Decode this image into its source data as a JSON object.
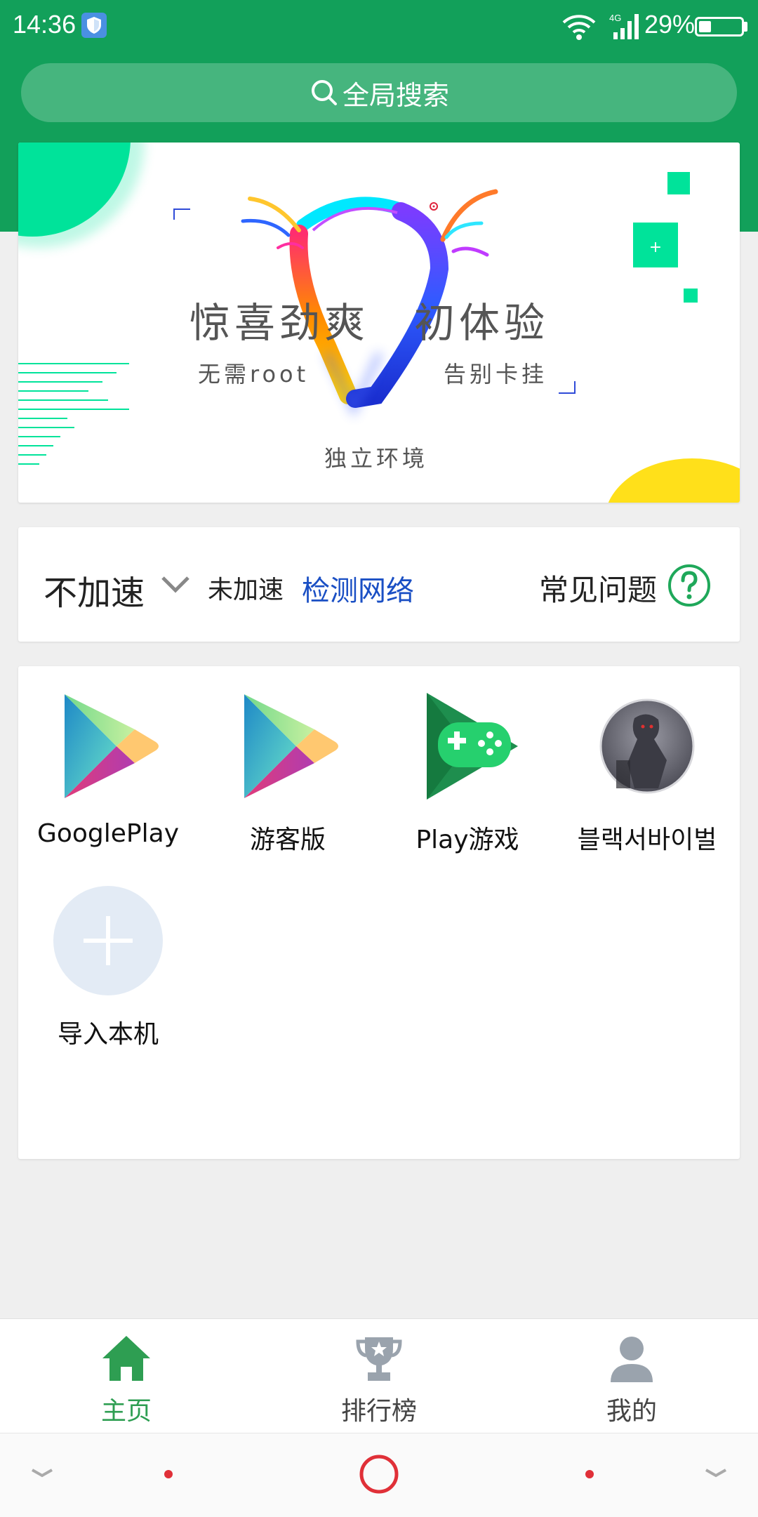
{
  "status_bar": {
    "time": "14:36",
    "network": "4G",
    "battery_percent": "29%",
    "battery_level": 0.29
  },
  "search": {
    "label": "全局搜索"
  },
  "banner": {
    "title": "惊喜劲爽　初体验",
    "sub_left": "无需root",
    "sub_right": "告别卡挂",
    "sub_bottom": "独立环境"
  },
  "speed": {
    "mode": "不加速",
    "status": "未加速",
    "check_network": "检测网络",
    "faq": "常见问题"
  },
  "apps": [
    {
      "label": "GooglePlay",
      "icon": "google-play-icon"
    },
    {
      "label": "游客版",
      "icon": "google-play-icon"
    },
    {
      "label": "Play游戏",
      "icon": "play-games-icon"
    },
    {
      "label": "블랙서바이벌",
      "icon": "game-avatar-icon"
    },
    {
      "label": "导入本机",
      "icon": "add-icon"
    }
  ],
  "bottom_nav": [
    {
      "label": "主页",
      "icon": "home-icon",
      "active": true
    },
    {
      "label": "排行榜",
      "icon": "trophy-icon",
      "active": false
    },
    {
      "label": "我的",
      "icon": "user-icon",
      "active": false
    }
  ],
  "colors": {
    "brand_green": "#12a05a",
    "link_blue": "#1a4fc4",
    "inactive_gray": "#9aa3ad"
  }
}
